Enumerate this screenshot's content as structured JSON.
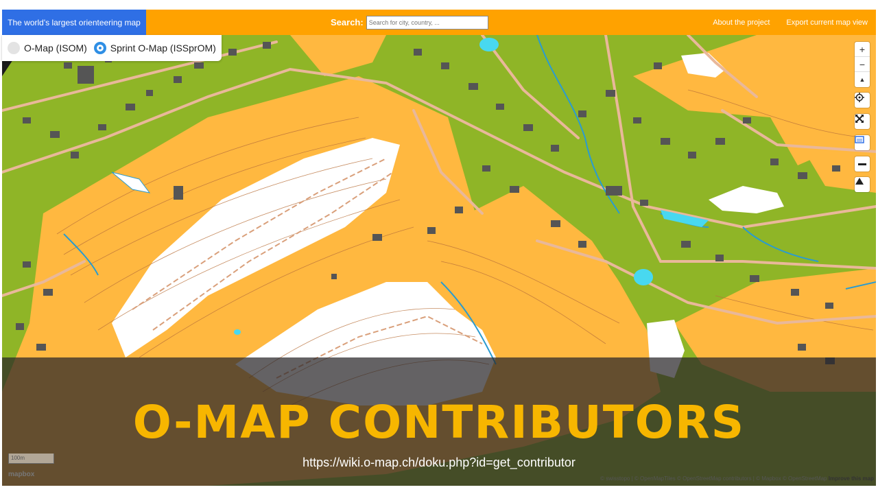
{
  "header": {
    "brand": "The world's largest orienteering map",
    "search_label": "Search:",
    "search_placeholder": "Search for city, country, ...",
    "links": [
      "About the project",
      "Export current map view"
    ]
  },
  "layers": [
    {
      "label": "O-Map (ISOM)",
      "selected": false
    },
    {
      "label": "Sprint O-Map (ISSprOM)",
      "selected": true
    }
  ],
  "controls": {
    "zoom_in": "+",
    "zoom_out": "−",
    "compass": "▲",
    "locate_icon": "crosshair-icon",
    "fullscreen_icon": "fullscreen-icon",
    "layers_icon": "layers-icon",
    "minus_icon": "minus-icon",
    "terrain_icon": "terrain-icon"
  },
  "banner": {
    "title": "O-MAP CONTRIBUTORS",
    "url": "https://wiki.o-map.ch/doku.php?id=get_contributor"
  },
  "map_footer": {
    "scale": "100m",
    "logo": "mapbox",
    "attribution": "© swisstopo | © OpenMapTiles © OpenStreetMap contributors | © Mapbox © OpenStreetMap",
    "improve": "Improve this map"
  },
  "colors": {
    "topbar": "#ffa200",
    "brand_bg": "#2f6fe5",
    "forest_green": "#8fb527",
    "open_land": "#ffb840",
    "title_accent": "#f7b600"
  }
}
